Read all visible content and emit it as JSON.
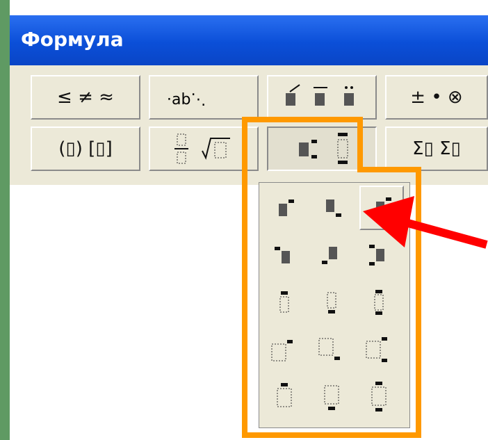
{
  "window": {
    "title": "Формула"
  },
  "toolbar": {
    "row1": [
      {
        "label": "≤ ≠ ≈",
        "icon": "relational-symbols-icon"
      },
      {
        "label": "∴ ab ⋱",
        "icon": "spaces-ellipses-icon"
      },
      {
        "label": "",
        "icon": "embellishments-icon"
      },
      {
        "label": "± • ⊗",
        "icon": "operator-symbols-icon"
      }
    ],
    "row2": [
      {
        "label": "(▯) [▯]",
        "icon": "fence-templates-icon"
      },
      {
        "label": "",
        "icon": "fraction-radical-templates-icon"
      },
      {
        "label": "",
        "icon": "subscript-superscript-templates-icon"
      },
      {
        "label": "Σ▯ Σ▯",
        "icon": "summation-templates-icon"
      }
    ]
  },
  "palette": {
    "items": [
      "superscript-right-icon",
      "subscript-right-icon",
      "sub-superscript-right-icon",
      "superscript-left-icon",
      "subscript-left-icon",
      "sub-superscript-left-icon",
      "overscript-icon",
      "underscript-icon",
      "over-underscript-icon",
      "superscript-right-large-icon",
      "subscript-right-large-icon",
      "sub-superscript-large-icon",
      "overscript-large-icon",
      "underscript-large-icon",
      "over-underscript-large-icon"
    ]
  },
  "colors": {
    "highlight": "#ff9900",
    "arrow": "#ff0000",
    "titlebar": "#0b4fd8"
  }
}
